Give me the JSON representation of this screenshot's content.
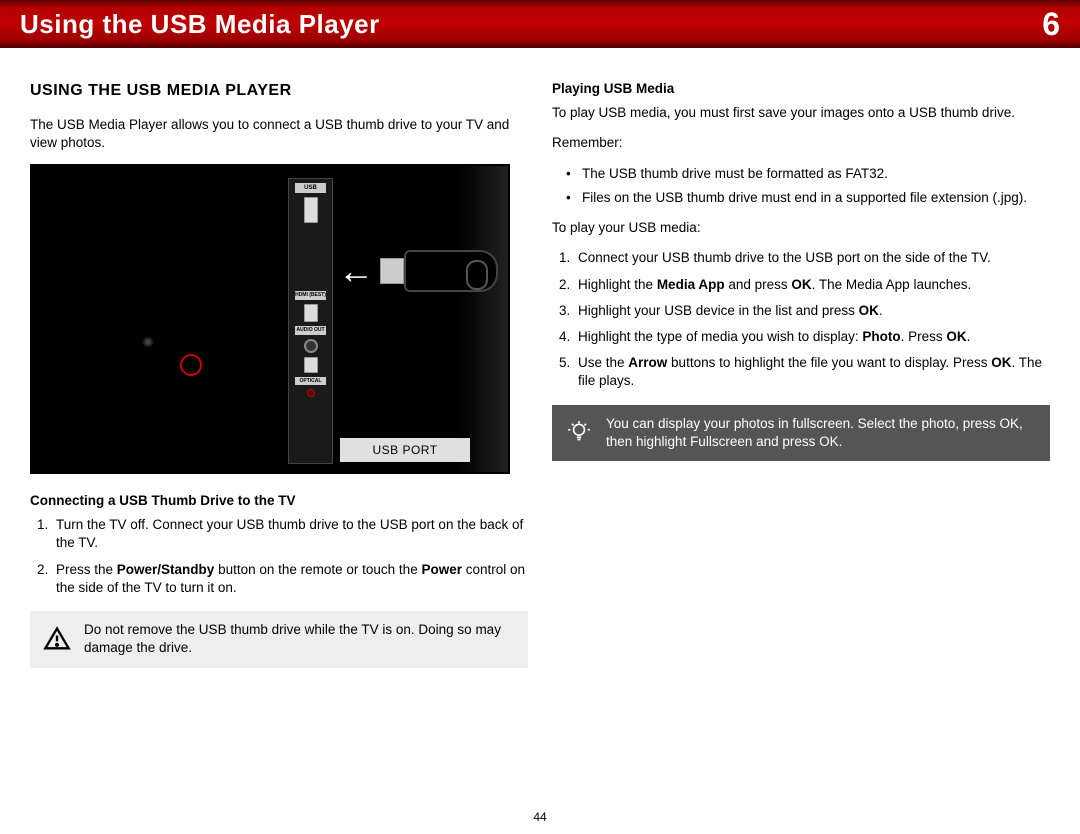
{
  "header": {
    "title": "Using the USB Media Player",
    "chapter": "6"
  },
  "left": {
    "heading": "USING THE USB MEDIA PLAYER",
    "intro": "The USB Media Player allows you to connect a USB thumb drive to your TV and view photos.",
    "diagram": {
      "usb_label": "USB",
      "hdmi_label": "HDMI (BEST)",
      "audio_label": "AUDIO OUT",
      "optical_label": "OPTICAL",
      "port_tag": "USB PORT"
    },
    "sub": "Connecting a USB Thumb Drive to the TV",
    "steps": {
      "1": "Turn the TV off. Connect your USB thumb drive to the USB port on the back of the TV.",
      "2_pre": "Press the ",
      "2_b1": "Power/Standby",
      "2_mid": " button on the remote or touch the ",
      "2_b2": "Power",
      "2_post": " control on the side of the TV to turn it on."
    },
    "warning": "Do not remove the USB thumb drive while the TV is on. Doing so may damage the drive."
  },
  "right": {
    "sub": "Playing USB Media",
    "intro": "To play USB media, you must first save your images onto a USB thumb drive.",
    "remember_label": "Remember:",
    "remember": {
      "0": "The USB thumb drive must be formatted as FAT32.",
      "1": "Files on the USB thumb drive must end in a supported file extension (.jpg)."
    },
    "play_label": "To play your USB media:",
    "steps": {
      "1": "Connect your USB thumb drive to the USB port on the side of the TV.",
      "2_pre": "Highlight the ",
      "2_b1": "Media App",
      "2_mid": " and press ",
      "2_b2": "OK",
      "2_post": ". The Media App launches.",
      "3_pre": "Highlight your USB device in the list and press ",
      "3_b1": "OK",
      "3_post": ".",
      "4_pre": "Highlight the type of media you wish to display: ",
      "4_b1": "Photo",
      "4_mid": ". Press ",
      "4_b2": "OK",
      "4_post": ".",
      "5_pre": "Use the ",
      "5_b1": "Arrow",
      "5_mid": " buttons to highlight the file you want to display. Press ",
      "5_b2": "OK",
      "5_post": ". The file plays."
    },
    "tip": "You can display your photos in fullscreen. Select the photo, press OK, then highlight Fullscreen and press OK."
  },
  "page": "44"
}
